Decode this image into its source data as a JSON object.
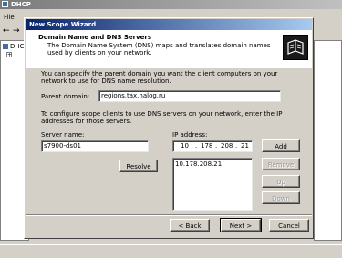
{
  "main_window": {
    "title": "DHCP",
    "menu_file": "File"
  },
  "tree": {
    "root_label": "DHC"
  },
  "wizard": {
    "title": "New Scope Wizard",
    "header_title": "Domain Name and DNS Servers",
    "header_desc": "The Domain Name System (DNS) maps and translates domain names used by clients on your network.",
    "intro_text": "You can specify the parent domain you want the client computers on your network to use for DNS name resolution.",
    "parent_domain_label": "Parent domain:",
    "parent_domain_value": "regions.tax.nalog.ru",
    "dns_text": "To configure scope clients to use DNS servers on your network, enter the IP addresses for those servers.",
    "server_name_label": "Server name:",
    "server_name_value": "s7900-ds01",
    "resolve_label": "Resolve",
    "ip_address_label": "IP address:",
    "ip_octets": [
      "10",
      "178",
      "208",
      "21"
    ],
    "ip_list": [
      "10.178.208.21"
    ],
    "add_label": "Add",
    "remove_label": "Remove",
    "up_label": "Up",
    "down_label": "Down",
    "back_label": "< Back",
    "next_label": "Next >",
    "cancel_label": "Cancel"
  },
  "colors": {
    "title_bar": "#0a246a",
    "title_bar_end": "#a6caf0",
    "face": "#d4d0c8"
  }
}
